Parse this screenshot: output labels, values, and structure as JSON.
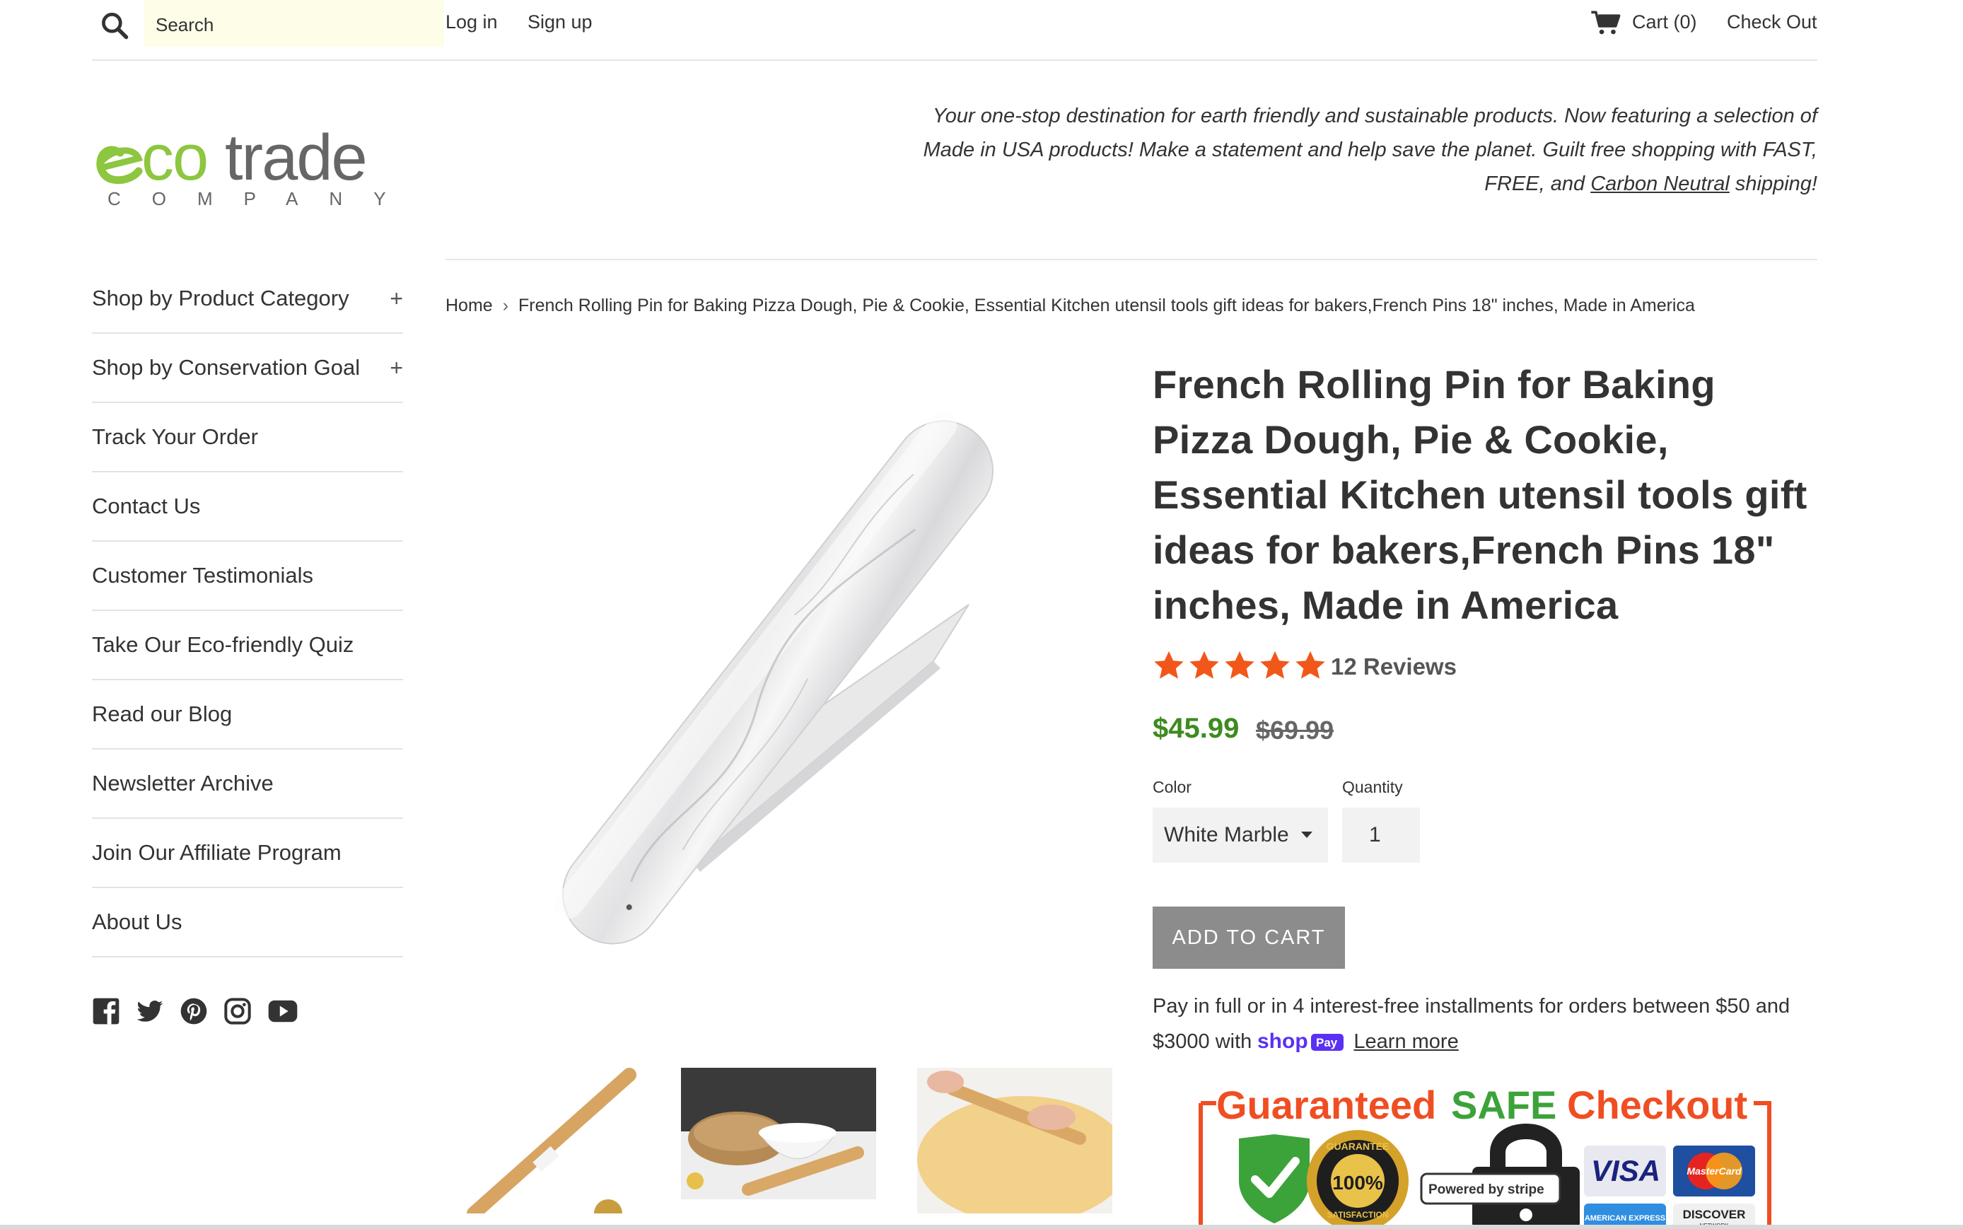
{
  "topbar": {
    "search_placeholder": "Search",
    "login": "Log in",
    "signup": "Sign up",
    "cart": "Cart (0)",
    "checkout": "Check Out"
  },
  "logo": {
    "word": "ecotrade",
    "sub": "C O M P A N Y"
  },
  "tagline": {
    "text_before": "Your one-stop destination for earth friendly and sustainable products. Now featuring a selection of Made in USA products! Make a statement and help save the planet. Guilt free shopping with FAST, FREE, and ",
    "link": "Carbon Neutral",
    "text_after": " shipping!"
  },
  "sidebar": {
    "items": [
      {
        "label": "Shop by Product Category",
        "expandable": true
      },
      {
        "label": "Shop by Conservation Goal",
        "expandable": true
      },
      {
        "label": "Track Your Order"
      },
      {
        "label": "Contact Us"
      },
      {
        "label": "Customer Testimonials"
      },
      {
        "label": "Take Our Eco-friendly Quiz"
      },
      {
        "label": "Read our Blog"
      },
      {
        "label": "Newsletter Archive"
      },
      {
        "label": "Join Our Affiliate Program"
      },
      {
        "label": "About Us"
      }
    ],
    "social": [
      "facebook-icon",
      "twitter-icon",
      "pinterest-icon",
      "instagram-icon",
      "youtube-icon"
    ]
  },
  "breadcrumb": {
    "home": "Home",
    "separator": "›",
    "current": "French Rolling Pin for Baking Pizza Dough, Pie & Cookie, Essential Kitchen utensil tools gift ideas for bakers,French Pins 18\" inches, Made in America"
  },
  "product": {
    "title": "French Rolling Pin for Baking Pizza Dough, Pie & Cookie, Essential Kitchen utensil tools gift ideas for bakers,French Pins 18\" inches, Made in America",
    "rating": 5,
    "reviews": "12 Reviews",
    "price": "$45.99",
    "compare_price": "$69.99",
    "color_label": "Color",
    "color_value": "White Marble",
    "quantity_label": "Quantity",
    "quantity_value": "1",
    "add_to_cart": "ADD TO CART",
    "installments_text": "Pay in full or in 4 interest-free installments for orders between $50 and $3000 with",
    "shoppay": "shop",
    "shoppay_pay": "Pay",
    "learn_more": "Learn more"
  },
  "badge": {
    "title_part1": "Guaranteed",
    "title_part2": "SAFE",
    "title_part3": "Checkout",
    "seal_top": "GUARANTEE",
    "seal_pct": "100%",
    "seal_bottom": "SATISFACTION",
    "stripe": "Powered by stripe",
    "visa": "VISA",
    "mastercard": "MasterCard",
    "amex": "AMERICAN EXPRESS",
    "discover": "DISCOVER",
    "discover_sub": "NETWORK"
  },
  "colors": {
    "accent_green": "#3d8b1f",
    "logo_green": "#8dc63f",
    "logo_gray": "#666666",
    "star": "#f2571a",
    "button_gray": "#8c8c8c",
    "badge_orange": "#ef4e23",
    "badge_green": "#3ca33a"
  }
}
